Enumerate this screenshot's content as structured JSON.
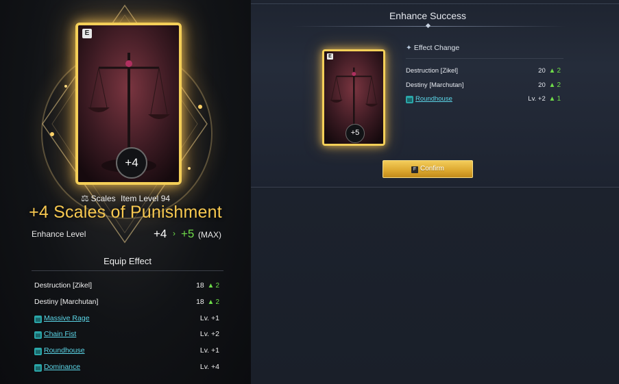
{
  "item": {
    "grade_badge": "E",
    "enhance_badge": "+4",
    "type_label": "Scales",
    "item_level_label": "Item Level",
    "item_level": "94",
    "title": "+4 Scales of Punishment",
    "enhance_level_label": "Enhance Level",
    "enhance_from": "+4",
    "enhance_to": "+5",
    "enhance_max": "(MAX)",
    "frame_color": "#f4cf58"
  },
  "equip_effect": {
    "header": "Equip Effect",
    "stats": [
      {
        "name": "Destruction [Zikel]",
        "value": "18",
        "up": "2"
      },
      {
        "name": "Destiny [Marchutan]",
        "value": "18",
        "up": "2"
      }
    ],
    "skills": [
      {
        "name": "Massive Rage",
        "value": "Lv. +1"
      },
      {
        "name": "Chain Fist",
        "value": "Lv. +2"
      },
      {
        "name": "Roundhouse",
        "value": "Lv. +1"
      },
      {
        "name": "Dominance",
        "value": "Lv. +4"
      }
    ]
  },
  "popup": {
    "title": "Enhance Success",
    "card_grade_badge": "E",
    "card_enhance_badge": "+5",
    "effect_header": "Effect Change",
    "effects": [
      {
        "name": "Destruction [Zikel]",
        "value": "20",
        "up": "2",
        "skill": false
      },
      {
        "name": "Destiny [Marchutan]",
        "value": "20",
        "up": "2",
        "skill": false
      },
      {
        "name": "Roundhouse",
        "value": "Lv. +2",
        "up": "1",
        "skill": true
      }
    ],
    "confirm_key": "F",
    "confirm_label": "Confirm"
  },
  "colors": {
    "gold": "#f7c850",
    "green_up": "#6fdc4a",
    "skill_link": "#5cd8ea"
  },
  "icons": {
    "scales": "scales-icon",
    "skill": "skill-book-icon",
    "up_arrow": "up-arrow-icon",
    "spark": "spark-icon"
  }
}
